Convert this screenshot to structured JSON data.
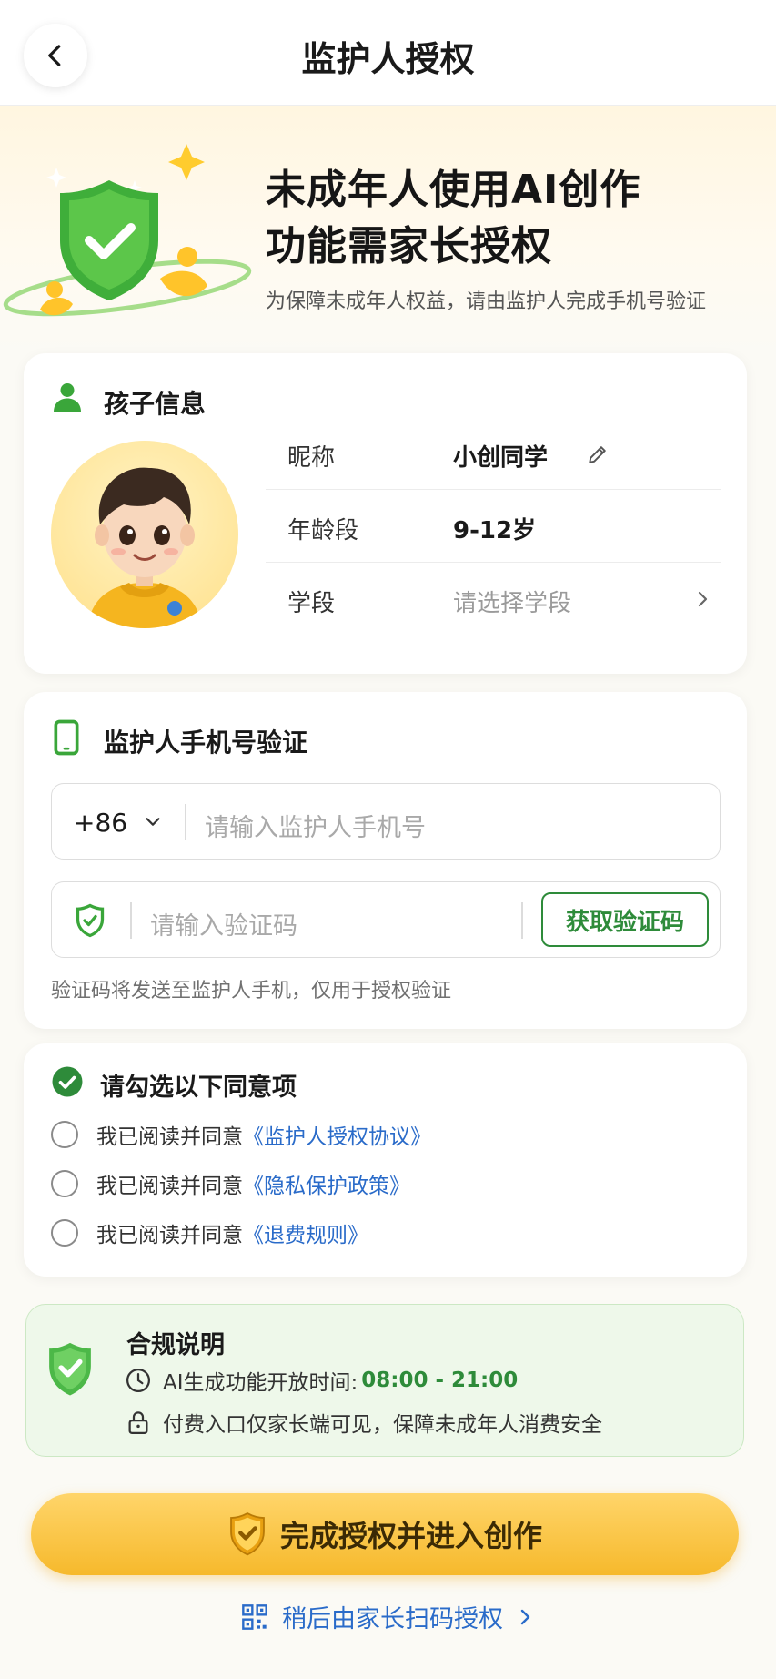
{
  "header": {
    "title": "监护人授权",
    "back_icon": "chevron-left-icon"
  },
  "hero": {
    "title_line1": "未成年人使用AI创作",
    "title_line2": "功能需家长授权",
    "subtitle": "为保障未成年人权益，请由监护人完成手机号验证"
  },
  "child_info": {
    "section_title": "孩子信息",
    "rows": [
      {
        "label": "昵称",
        "value": "小创同学"
      },
      {
        "label": "年龄段",
        "value": "9-12岁"
      },
      {
        "label": "学段",
        "placeholder": "请选择学段"
      }
    ]
  },
  "phone_verify": {
    "section_title": "监护人手机号验证",
    "country_code": "+86",
    "phone_placeholder": "请输入监护人手机号",
    "code_placeholder": "请输入验证码",
    "get_code_label": "获取验证码",
    "hint": "验证码将发送至监护人手机，仅用于授权验证"
  },
  "agreements": {
    "section_title": "请勾选以下同意项",
    "items": [
      {
        "prefix": "我已阅读并同意",
        "link": "《监护人授权协议》"
      },
      {
        "prefix": "我已阅读并同意",
        "link": "《隐私保护政策》"
      },
      {
        "prefix": "我已阅读并同意",
        "link": "《退费规则》"
      }
    ]
  },
  "compliance": {
    "title": "合规说明",
    "time_label": "AI生成功能开放时间:",
    "time_value": "08:00 - 21:00",
    "payment_note": "付费入口仅家长端可见，保障未成年人消费安全"
  },
  "actions": {
    "primary_label": "完成授权并进入创作",
    "secondary_label": "稍后由家长扫码授权"
  },
  "colors": {
    "accent_green": "#2e8b3a",
    "link_blue": "#2a6bc9",
    "button_yellow": "#f6b92c"
  }
}
